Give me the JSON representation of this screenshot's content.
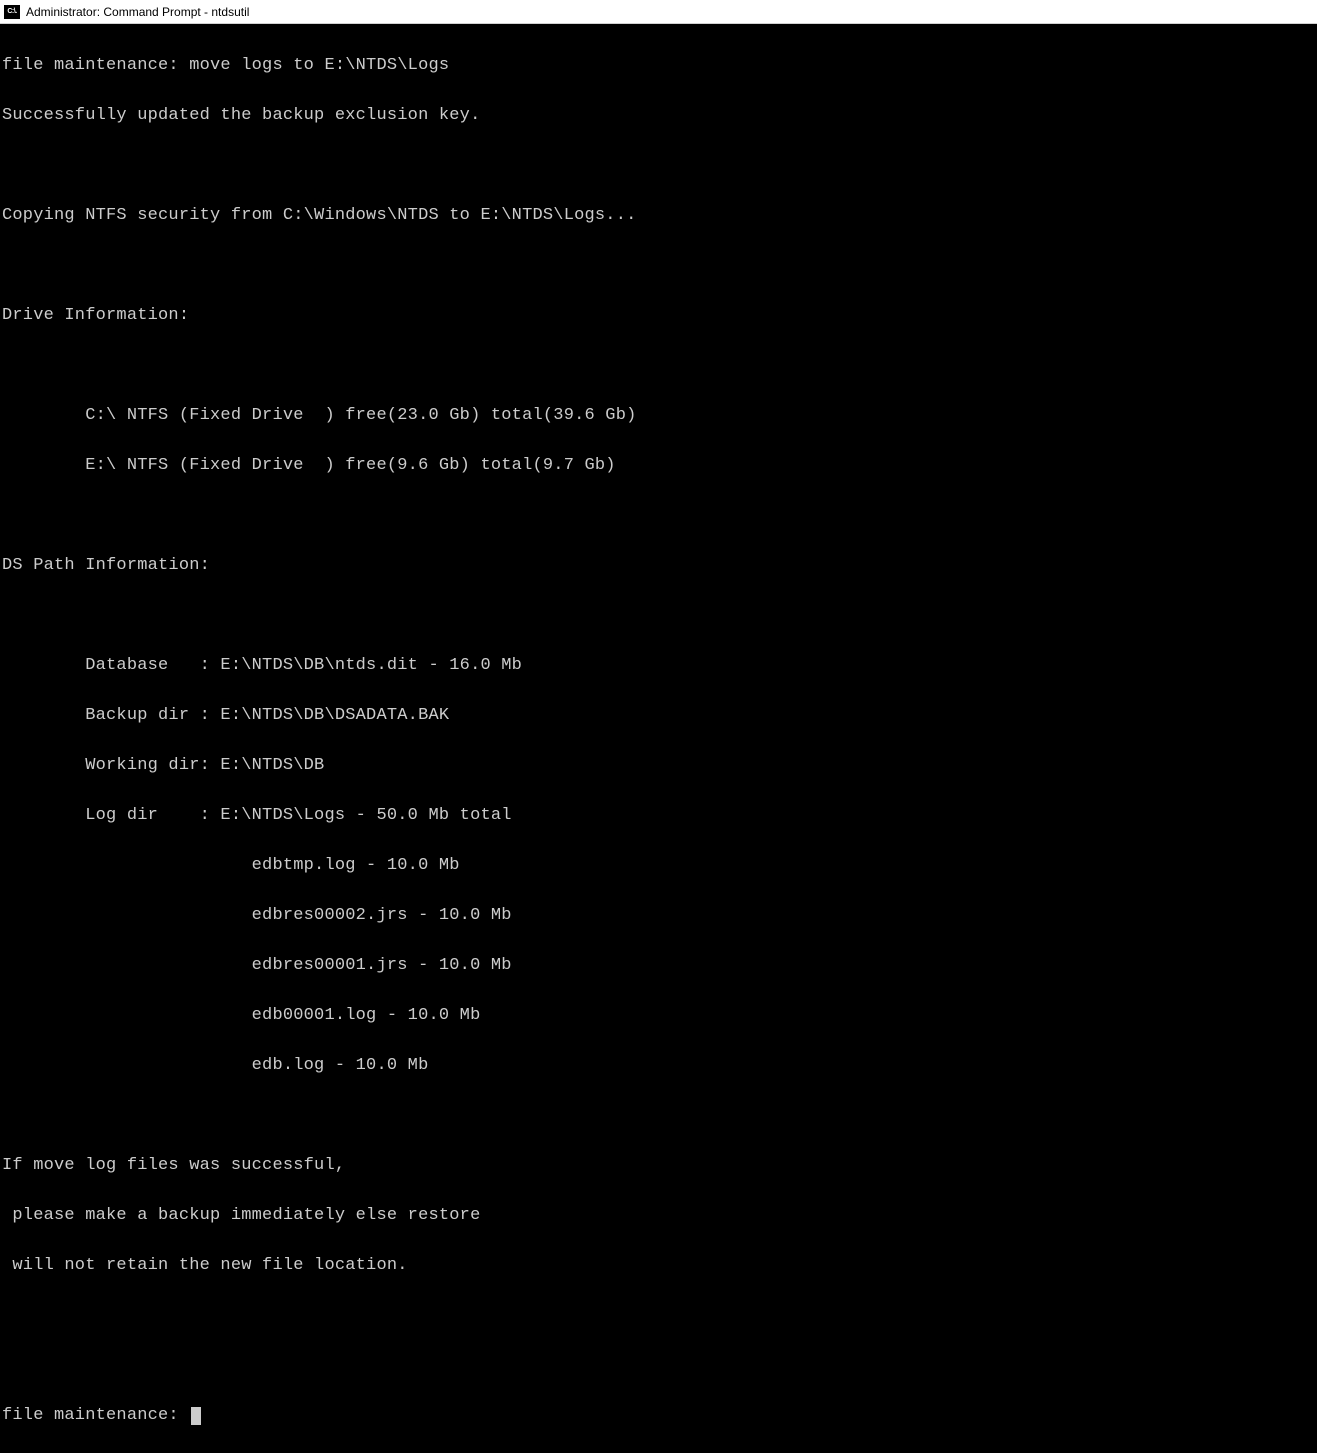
{
  "titlebar": {
    "icon_label": "C:\\.",
    "text": "Administrator: Command Prompt - ntdsutil"
  },
  "terminal": {
    "lines": [
      "file maintenance: move logs to E:\\NTDS\\Logs",
      "Successfully updated the backup exclusion key.",
      "",
      "Copying NTFS security from C:\\Windows\\NTDS to E:\\NTDS\\Logs...",
      "",
      "Drive Information:",
      "",
      "        C:\\ NTFS (Fixed Drive  ) free(23.0 Gb) total(39.6 Gb)",
      "        E:\\ NTFS (Fixed Drive  ) free(9.6 Gb) total(9.7 Gb)",
      "",
      "DS Path Information:",
      "",
      "        Database   : E:\\NTDS\\DB\\ntds.dit - 16.0 Mb",
      "        Backup dir : E:\\NTDS\\DB\\DSADATA.BAK",
      "        Working dir: E:\\NTDS\\DB",
      "        Log dir    : E:\\NTDS\\Logs - 50.0 Mb total",
      "                        edbtmp.log - 10.0 Mb",
      "                        edbres00002.jrs - 10.0 Mb",
      "                        edbres00001.jrs - 10.0 Mb",
      "                        edb00001.log - 10.0 Mb",
      "                        edb.log - 10.0 Mb",
      "",
      "If move log files was successful,",
      " please make a backup immediately else restore",
      " will not retain the new file location.",
      "",
      ""
    ],
    "prompt": "file maintenance: "
  }
}
